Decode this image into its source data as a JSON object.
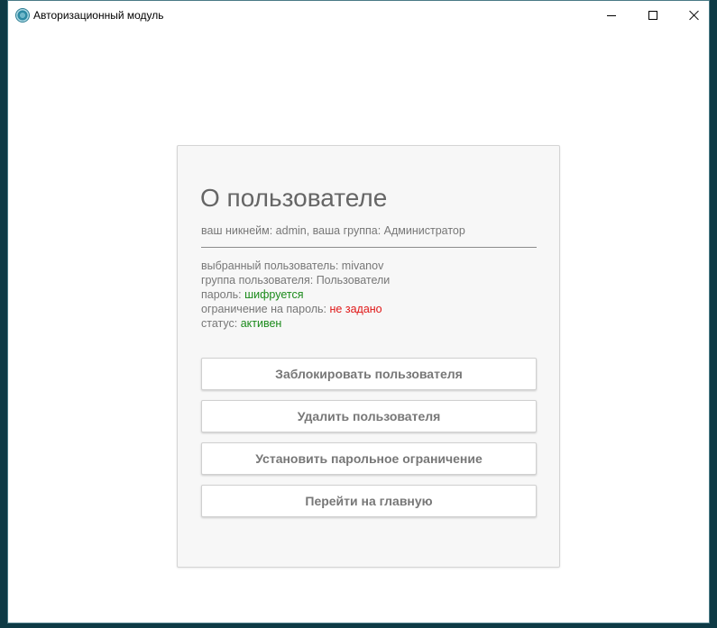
{
  "window": {
    "title": "Авторизационный модуль"
  },
  "card": {
    "title": "О пользователе",
    "subtitle": "ваш никнейм: admin, ваша группа: Администратор",
    "info": [
      {
        "label": "выбранный пользователь: ",
        "value": "mivanov"
      },
      {
        "label": "группа пользователя: ",
        "value": "Пользователи"
      },
      {
        "label": "пароль: ",
        "value": "шифруется"
      },
      {
        "label": "ограничение на пароль: ",
        "value": "не задано"
      },
      {
        "label": "статус: ",
        "value": "активен"
      }
    ],
    "buttons": {
      "block": "Заблокировать пользователя",
      "delete": "Удалить пользователя",
      "restrict": "Установить парольное ограничение",
      "home": "Перейти на главную"
    }
  },
  "colors": {
    "ok": "#1a8a1a",
    "warning": "#e01818"
  }
}
